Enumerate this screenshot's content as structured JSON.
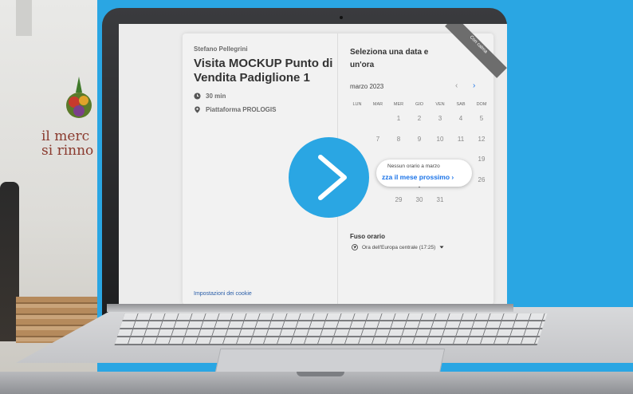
{
  "background": {
    "sign_text_1": "il merc",
    "sign_text_2": "si rinno"
  },
  "booking": {
    "host": "Stefano Pellegrini",
    "title": "Visita MOCKUP Punto di Vendita Padiglione 1",
    "duration": "30 min",
    "location": "Piattaforma PROLOGIS",
    "cookie_link": "Impostazioni dei cookie",
    "ribbon": "Con calma"
  },
  "calendar": {
    "heading": "Seleziona una data e un'ora",
    "month": "marzo 2023",
    "prev_icon": "‹",
    "next_icon": "›",
    "weekdays": [
      "LUN",
      "MAR",
      "MER",
      "GIO",
      "VEN",
      "SAB",
      "DOM"
    ],
    "week1": [
      "",
      "",
      "1",
      "2",
      "3",
      "4",
      "5"
    ],
    "week2": [
      "",
      "7",
      "8",
      "9",
      "10",
      "11",
      "12"
    ],
    "week3": [
      "",
      "",
      "",
      "",
      "",
      "",
      "19"
    ],
    "week4": [
      "",
      "",
      "22",
      "23",
      "24",
      "25",
      "26"
    ],
    "week5": [
      "",
      "",
      "29",
      "30",
      "31",
      "",
      ""
    ],
    "tooltip_line1": "Nessun orario a marzo",
    "tooltip_line2": "zza il mese prossimo",
    "tooltip_chevron": "›",
    "timezone_label": "Fuso orario",
    "timezone_value": "Ora dell'Europa centrale (17:25)"
  },
  "colors": {
    "accent": "#2aa6e3",
    "link": "#1a73e8"
  }
}
